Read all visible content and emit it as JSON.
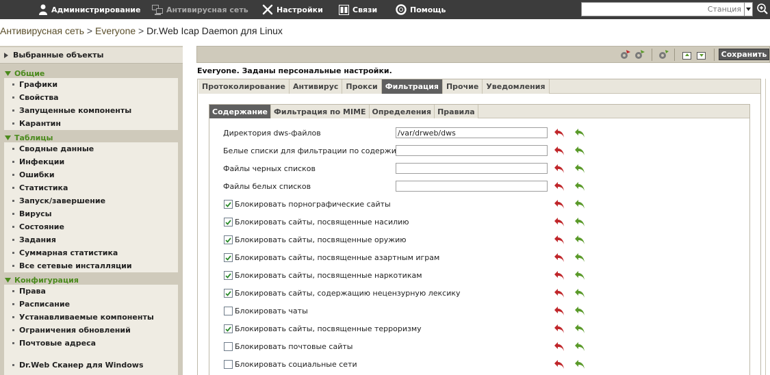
{
  "topbar": {
    "items": [
      {
        "label": "Администрирование",
        "icon": "admin-icon",
        "enabled": true
      },
      {
        "label": "Антивирусная сеть",
        "icon": "network-icon",
        "enabled": false
      },
      {
        "label": "Настройки",
        "icon": "tools-icon",
        "enabled": true
      },
      {
        "label": "Связи",
        "icon": "links-icon",
        "enabled": true
      },
      {
        "label": "Помощь",
        "icon": "help-icon",
        "enabled": true
      }
    ],
    "search": {
      "placeholder": "Станция",
      "value": ""
    },
    "zoom_icon": "zoom-in-icon"
  },
  "breadcrumb": {
    "part1": "Антивирусная сеть",
    "sep1": " > ",
    "part2": "Everyone",
    "sep2": " > ",
    "current": "Dr.Web Icap Daemon для Linux"
  },
  "sidebar": {
    "selected_objects": "Выбранные объекты",
    "sections": [
      {
        "title": "Общие",
        "items": [
          "Графики",
          "Свойства",
          "Запущенные компоненты",
          "Карантин"
        ]
      },
      {
        "title": "Таблицы",
        "items": [
          "Сводные данные",
          "Инфекции",
          "Ошибки",
          "Статистика",
          "Запуск/завершение",
          "Вирусы",
          "Состояние",
          "Задания",
          "Суммарная статистика",
          "Все сетевые инсталляции"
        ]
      },
      {
        "title": "Конфигурация",
        "items": [
          "Права",
          "Расписание",
          "Устанавливаемые компоненты",
          "Ограничения обновлений",
          "Почтовые адреса",
          "Dr.Web Сканер для Windows"
        ]
      }
    ]
  },
  "toolbar": {
    "save_label": "Сохранить"
  },
  "main": {
    "note": "Everyone. Заданы персональные настройки.",
    "outer_tabs": [
      "Протоколирование",
      "Антивирус",
      "Прокси",
      "Фильтрация",
      "Прочие",
      "Уведомления"
    ],
    "outer_active": 3,
    "inner_tabs": [
      "Содержание",
      "Фильтрация по MIME",
      "Определения",
      "Правила"
    ],
    "inner_active": 0,
    "text_fields": [
      {
        "label": "Директория dws-файлов",
        "value": "/var/drweb/dws"
      },
      {
        "label": "Белые списки для фильтрации по содержимому",
        "value": ""
      },
      {
        "label": "Файлы черных списков",
        "value": ""
      },
      {
        "label": "Файлы белых списков",
        "value": ""
      }
    ],
    "checkboxes": [
      {
        "label": "Блокировать порнографические сайты",
        "checked": true
      },
      {
        "label": "Блокировать сайты, посвященные насилию",
        "checked": true
      },
      {
        "label": "Блокировать сайты, посвященные оружию",
        "checked": true
      },
      {
        "label": "Блокировать сайты, посвященные азартным играм",
        "checked": true
      },
      {
        "label": "Блокировать сайты, посвященные наркотикам",
        "checked": true
      },
      {
        "label": "Блокировать сайты, содержащию нецензурную лексику",
        "checked": true
      },
      {
        "label": "Блокировать чаты",
        "checked": false
      },
      {
        "label": "Блокировать сайты, посвященные терроризму",
        "checked": true
      },
      {
        "label": "Блокировать почтовые сайты",
        "checked": false
      },
      {
        "label": "Блокировать социальные сети",
        "checked": false
      }
    ]
  },
  "colors": {
    "topbar": "#3c3c3c",
    "section_title": "#4a8a1c",
    "active_tab": "#5f5f5f",
    "reset_arrow": "#c0262a",
    "default_arrow": "#5a9a2a"
  }
}
